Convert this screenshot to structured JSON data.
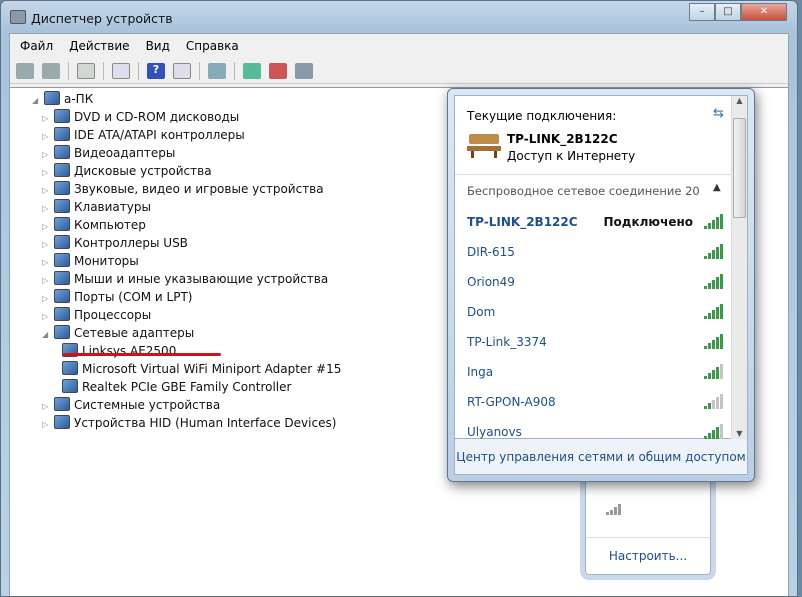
{
  "window": {
    "title": "Диспетчер устройств",
    "controls": [
      "–",
      "□",
      "✕"
    ]
  },
  "menu": [
    "Файл",
    "Действие",
    "Вид",
    "Справка"
  ],
  "toolbar_icons": [
    "back-icon",
    "forward-icon",
    "show-hide-tree-icon",
    "properties-icon",
    "help-icon",
    "action-pane-icon",
    "scan-hardware-icon",
    "update-driver-icon",
    "disable-device-icon",
    "uninstall-device-icon"
  ],
  "tree": {
    "root": "a-ПК",
    "categories": [
      {
        "label": "DVD и CD-ROM дисководы",
        "expanded": false
      },
      {
        "label": "IDE ATA/ATAPI контроллеры",
        "expanded": false
      },
      {
        "label": "Видеоадаптеры",
        "expanded": false
      },
      {
        "label": "Дисковые устройства",
        "expanded": false
      },
      {
        "label": "Звуковые, видео и игровые устройства",
        "expanded": false
      },
      {
        "label": "Клавиатуры",
        "expanded": false
      },
      {
        "label": "Компьютер",
        "expanded": false
      },
      {
        "label": "Контроллеры USB",
        "expanded": false
      },
      {
        "label": "Мониторы",
        "expanded": false
      },
      {
        "label": "Мыши и иные указывающие устройства",
        "expanded": false
      },
      {
        "label": "Порты (COM и LPT)",
        "expanded": false
      },
      {
        "label": "Процессоры",
        "expanded": false
      },
      {
        "label": "Сетевые адаптеры",
        "expanded": true,
        "children": [
          "Linksys AE2500",
          "Microsoft Virtual WiFi Miniport Adapter #15",
          "Realtek PCIe GBE Family Controller"
        ]
      },
      {
        "label": "Системные устройства",
        "expanded": false
      },
      {
        "label": "Устройства HID (Human Interface Devices)",
        "expanded": false
      }
    ],
    "highlight_color": "#d0111b"
  },
  "network_popup": {
    "current_label": "Текущие подключения:",
    "current_name": "TP-LINK_2B122C",
    "current_status": "Доступ к Интернету",
    "section": "Беспроводное сетевое соединение 20",
    "networks": [
      {
        "name": "TP-LINK_2B122C",
        "status": "Подключено",
        "signal": 5
      },
      {
        "name": "DIR-615",
        "signal": 5
      },
      {
        "name": "Orion49",
        "signal": 5
      },
      {
        "name": "Dom",
        "signal": 5
      },
      {
        "name": "TP-Link_3374",
        "signal": 5
      },
      {
        "name": "Inga",
        "signal": 4
      },
      {
        "name": "RT-GPON-A908",
        "signal": 2
      },
      {
        "name": "Ulyanovs",
        "signal": 4
      }
    ],
    "footer_link": "Центр управления сетями и общим доступом"
  },
  "back_popup": {
    "link": "Настроить..."
  }
}
